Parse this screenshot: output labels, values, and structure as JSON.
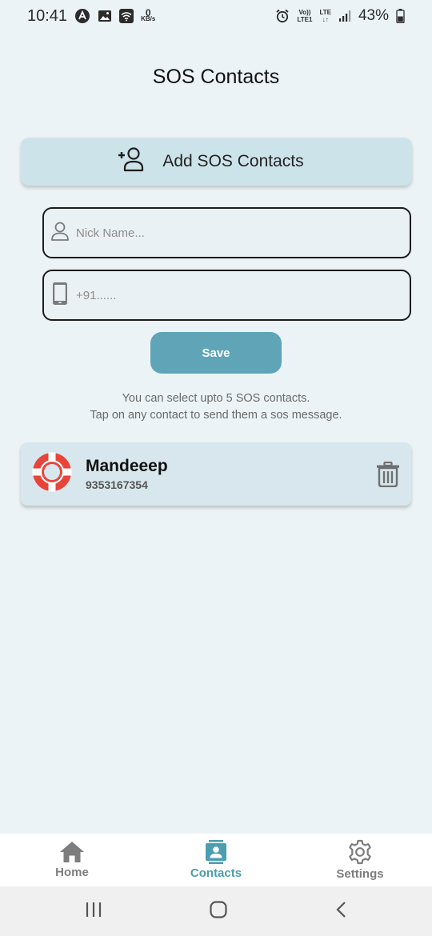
{
  "status_bar": {
    "time": "10:41",
    "speed_value": "0",
    "speed_unit": "KB/s",
    "volte": "Vo))",
    "lte1": "LTE1",
    "lte": "LTE",
    "battery_percent": "43%"
  },
  "page": {
    "title": "SOS Contacts"
  },
  "add_button": {
    "label": "Add SOS Contacts"
  },
  "form": {
    "name_placeholder": "Nick Name...",
    "phone_placeholder": "+91......",
    "save_label": "Save"
  },
  "hint": {
    "line1": "You can select upto 5 SOS contacts.",
    "line2": "Tap on any contact to send them a sos message."
  },
  "contacts": [
    {
      "name": "Mandeeep",
      "phone": "9353167354"
    }
  ],
  "bottom_nav": {
    "items": [
      {
        "label": "Home",
        "icon": "home-icon"
      },
      {
        "label": "Contacts",
        "icon": "contacts-icon"
      },
      {
        "label": "Settings",
        "icon": "gear-icon"
      }
    ],
    "active": "Contacts"
  },
  "colors": {
    "accent": "#5fa5b7",
    "background": "#ebf3f6",
    "card": "#d7e7ed",
    "sos_red": "#e8443a"
  }
}
